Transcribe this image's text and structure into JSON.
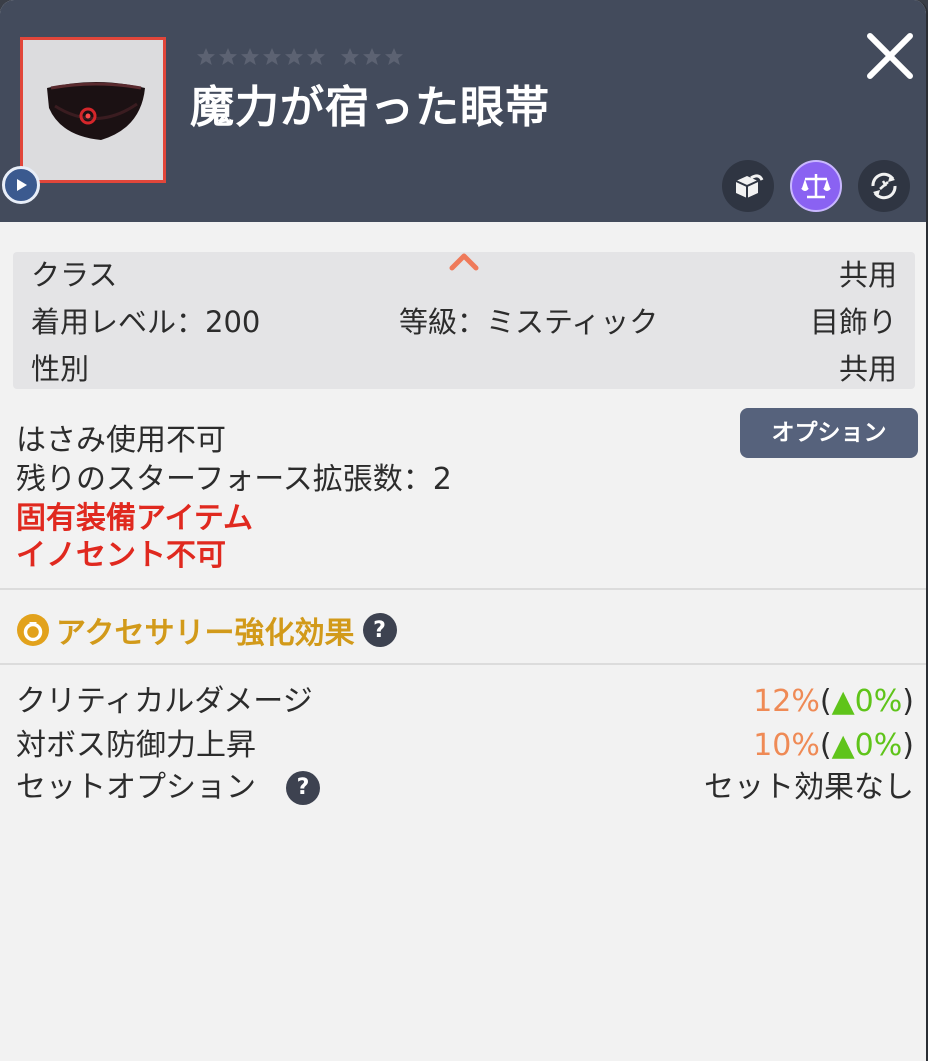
{
  "item": {
    "name": "魔力が宿った眼帯",
    "stars_filled": 0,
    "stars_total": 9
  },
  "header_icons": [
    "box-transfer-icon",
    "scale-icon",
    "reset-icon"
  ],
  "info": {
    "class_label": "クラス",
    "class_value": "共用",
    "level_label": "着用レベル：200",
    "grade_label": "等級：ミスティック",
    "category_value": "目飾り",
    "gender_label": "性別",
    "gender_value": "共用"
  },
  "option_button": "オプション",
  "attributes": {
    "scissors": "はさみ使用不可",
    "starforce": "残りのスターフォース拡張数：2",
    "unique": "固有装備アイテム",
    "innocent": "イノセント不可"
  },
  "accessory": {
    "label": "アクセサリー強化効果"
  },
  "stats": [
    {
      "label": "クリティカルダメージ",
      "value": "12%",
      "paren_open": "(",
      "delta": "▲0%",
      "paren_close": ")"
    },
    {
      "label": "対ボス防御力上昇",
      "value": "10%",
      "paren_open": "(",
      "delta": "▲0%",
      "paren_close": ")"
    }
  ],
  "set_option": {
    "label": "セットオプション",
    "value": "セット効果なし"
  },
  "colors": {
    "header_bg": "#434b5c",
    "panel_bg": "#f2f2f2",
    "red_text": "#e0291f",
    "accent_gold": "#d29a1a",
    "stat_orange": "#ef8a55",
    "stat_green": "#5fc41a",
    "frame_red": "#e1463a",
    "scale_purple": "#8a62f2"
  }
}
